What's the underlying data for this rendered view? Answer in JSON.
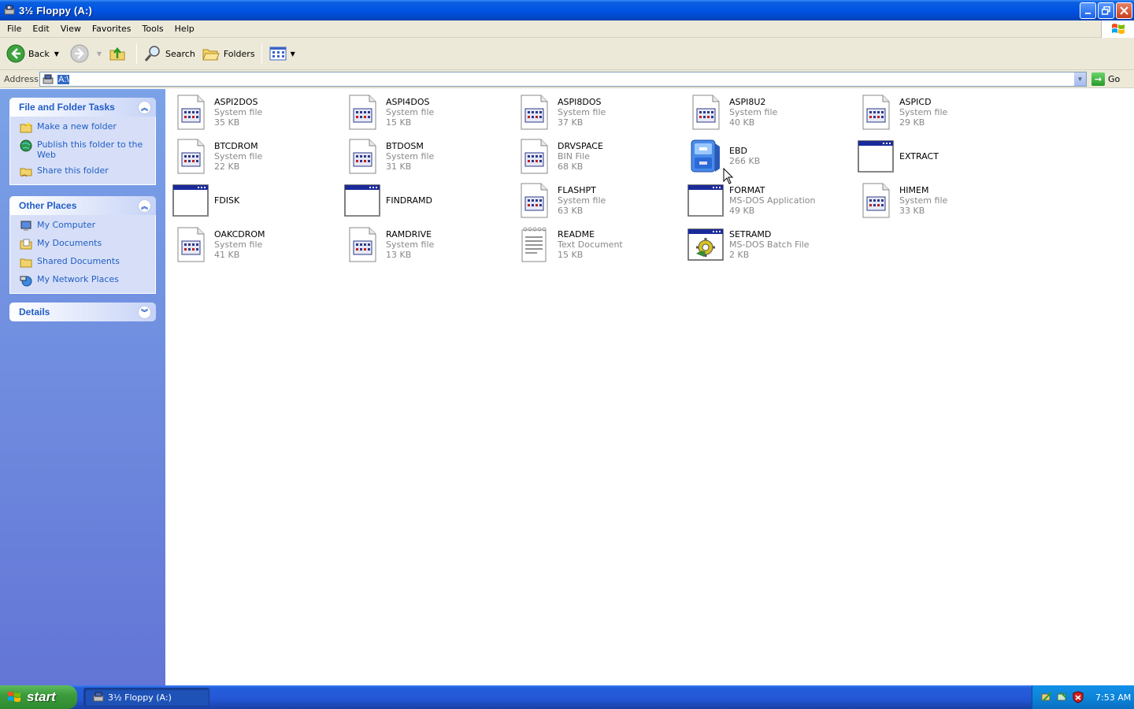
{
  "window": {
    "title": "3½ Floppy (A:)",
    "buttons": [
      "minimize",
      "restore",
      "close"
    ]
  },
  "menu": [
    "File",
    "Edit",
    "View",
    "Favorites",
    "Tools",
    "Help"
  ],
  "toolbar": {
    "back_label": "Back",
    "search_label": "Search",
    "folders_label": "Folders"
  },
  "address": {
    "label": "Address",
    "value": "A:\\",
    "go_label": "Go"
  },
  "tasks_panel": {
    "title": "File and Folder Tasks",
    "links": [
      "Make a new folder",
      "Publish this folder to the Web",
      "Share this folder"
    ]
  },
  "places_panel": {
    "title": "Other Places",
    "links": [
      "My Computer",
      "My Documents",
      "Shared Documents",
      "My Network Places"
    ]
  },
  "details_panel": {
    "title": "Details"
  },
  "files": [
    {
      "name": "ASPI2DOS",
      "type": "System file",
      "size": "35 KB",
      "icon": "system-file-icon"
    },
    {
      "name": "ASPI4DOS",
      "type": "System file",
      "size": "15 KB",
      "icon": "system-file-icon"
    },
    {
      "name": "ASPI8DOS",
      "type": "System file",
      "size": "37 KB",
      "icon": "system-file-icon"
    },
    {
      "name": "ASPI8U2",
      "type": "System file",
      "size": "40 KB",
      "icon": "system-file-icon"
    },
    {
      "name": "ASPICD",
      "type": "System file",
      "size": "29 KB",
      "icon": "system-file-icon"
    },
    {
      "name": "BTCDROM",
      "type": "System file",
      "size": "22 KB",
      "icon": "system-file-icon"
    },
    {
      "name": "BTDOSM",
      "type": "System file",
      "size": "31 KB",
      "icon": "system-file-icon"
    },
    {
      "name": "DRVSPACE",
      "type": "BIN File",
      "size": "68 KB",
      "icon": "system-file-icon"
    },
    {
      "name": "EBD",
      "type": "",
      "size": "266 KB",
      "icon": "cabinet-file-icon"
    },
    {
      "name": "EXTRACT",
      "type": "",
      "size": "",
      "icon": "dos-app-icon"
    },
    {
      "name": "FDISK",
      "type": "",
      "size": "",
      "icon": "dos-app-icon"
    },
    {
      "name": "FINDRAMD",
      "type": "",
      "size": "",
      "icon": "dos-app-icon"
    },
    {
      "name": "FLASHPT",
      "type": "System file",
      "size": "63 KB",
      "icon": "system-file-icon"
    },
    {
      "name": "FORMAT",
      "type": "MS-DOS Application",
      "size": "49 KB",
      "icon": "dos-app-icon"
    },
    {
      "name": "HIMEM",
      "type": "System file",
      "size": "33 KB",
      "icon": "system-file-icon"
    },
    {
      "name": "OAKCDROM",
      "type": "System file",
      "size": "41 KB",
      "icon": "system-file-icon"
    },
    {
      "name": "RAMDRIVE",
      "type": "System file",
      "size": "13 KB",
      "icon": "system-file-icon"
    },
    {
      "name": "README",
      "type": "Text Document",
      "size": "15 KB",
      "icon": "text-document-icon"
    },
    {
      "name": "SETRAMD",
      "type": "MS-DOS Batch File",
      "size": "2 KB",
      "icon": "batch-file-icon"
    }
  ],
  "taskbar": {
    "start_label": "start",
    "task_label": "3½ Floppy (A:)",
    "clock": "7:53 AM"
  },
  "colors": {
    "titlebar": "#0054e3",
    "taskpane_link": "#215dc6",
    "taskpane_bg": "#6375d6"
  }
}
